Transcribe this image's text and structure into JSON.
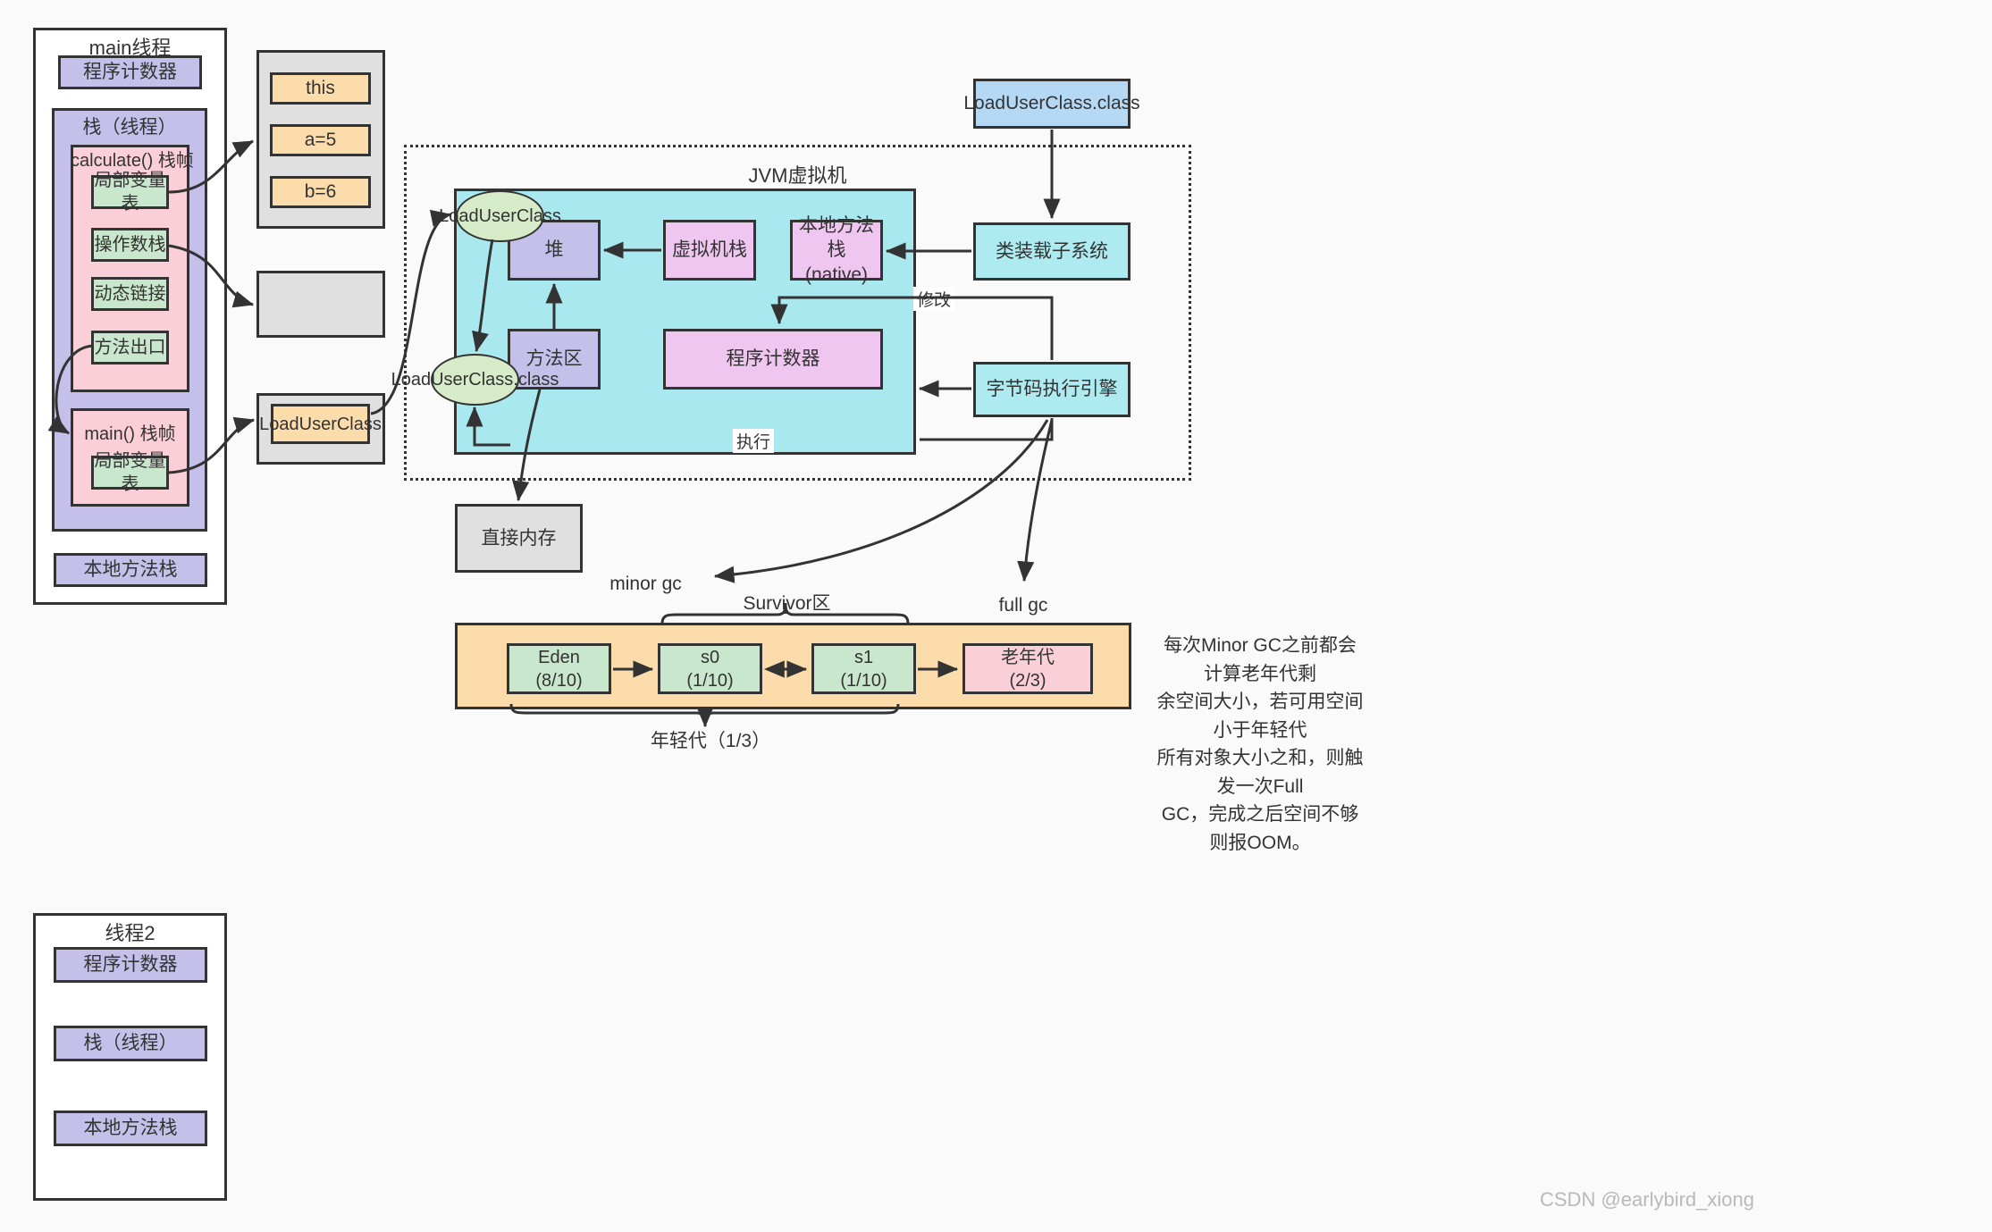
{
  "watermark": "CSDN @earlybird_xiong",
  "main_thread": {
    "title": "main线程",
    "pc": "程序计数器",
    "stack_title": "栈（线程）",
    "calculate_frame": {
      "title": "calculate() 栈帧",
      "slots": [
        "局部变量表",
        "操作数栈",
        "动态链接",
        "方法出口"
      ]
    },
    "main_frame": {
      "title": "main() 栈帧",
      "slots": [
        "局部变量表"
      ]
    },
    "native_stack": "本地方法栈"
  },
  "thread2": {
    "title": "线程2",
    "items": [
      "程序计数器",
      "栈（线程）",
      "本地方法栈"
    ]
  },
  "heap_group_1": {
    "items": [
      "this",
      "a=5",
      "b=6"
    ]
  },
  "heap_group_2": {
    "items": []
  },
  "heap_group_3": {
    "items": [
      "LoadUserClass"
    ]
  },
  "jvm": {
    "title": "JVM虚拟机",
    "heap": "堆",
    "vm_stack": "虚拟机栈",
    "native_stack": "本地方法栈\n(native)",
    "method_area": "方法区",
    "pc_register": "程序计数器",
    "ellipse_top": "LoadUserClass",
    "ellipse_bottom": "LoadUserClass.class",
    "exec_label": "执行",
    "modify_label": "修改"
  },
  "right_column": {
    "class_file": "LoadUserClass.class",
    "classloader": "类装载子系统",
    "engine": "字节码执行引擎"
  },
  "direct_memory": "直接内存",
  "gc": {
    "minor": "minor gc",
    "full": "full gc",
    "survivor_label": "Survivor区",
    "young_label": "年轻代（1/3）"
  },
  "memory_regions": [
    {
      "name": "Eden",
      "ratio": "(8/10)"
    },
    {
      "name": "s0",
      "ratio": "(1/10)"
    },
    {
      "name": "s1",
      "ratio": "(1/10)"
    },
    {
      "name": "老年代",
      "ratio": "(2/3)"
    }
  ],
  "note": "每次Minor GC之前都会计算老年代剩\n余空间大小，若可用空间小于年轻代\n所有对象大小之和，则触发一次Full\nGC，完成之后空间不够则报OOM。",
  "colors": {
    "purple": "#c5c0ea",
    "pink": "#fbcfd8",
    "green": "#c9e7cd",
    "gray": "#e0e0e0",
    "orange": "#fcdcab",
    "cyan": "#aeebf0",
    "lightblue": "#b5d9f5",
    "magenta": "#eec6ef",
    "stroke": "#333333"
  }
}
